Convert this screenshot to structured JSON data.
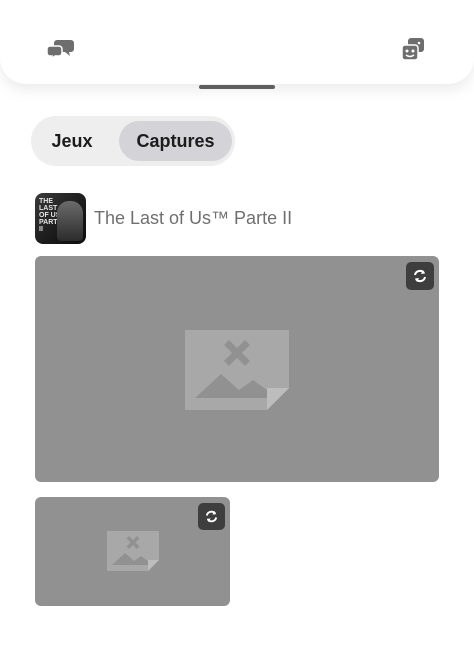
{
  "header": {
    "left_icon": "chat-bubbles-icon",
    "right_icon": "game-library-icon"
  },
  "tabs": [
    {
      "label": "Jeux",
      "selected": false
    },
    {
      "label": "Captures",
      "selected": true
    }
  ],
  "game": {
    "title": "The Last of Us™ Parte II",
    "cover_icon": "game-cover-icon",
    "cover_text": "THE LAST OF US PART II"
  },
  "captures": [
    {
      "status_icon": "sync-icon",
      "thumbnail_icon": "broken-image-icon"
    },
    {
      "status_icon": "sync-icon",
      "thumbnail_icon": "broken-image-icon"
    }
  ],
  "colors": {
    "placeholder": "#919191",
    "badge": "#3e3e3e",
    "selected_tab": "#d4d4d8"
  }
}
